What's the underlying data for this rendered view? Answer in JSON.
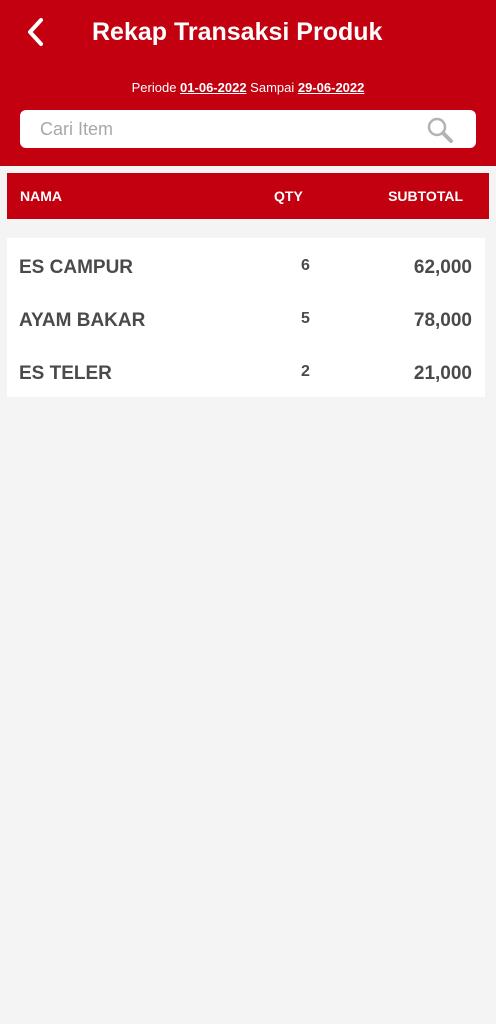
{
  "header": {
    "title": "Rekap Transaksi Produk",
    "period": {
      "prefix": "Periode",
      "start_date": "01-06-2022",
      "middle": "Sampai",
      "end_date": "29-06-2022"
    }
  },
  "search": {
    "placeholder": "Cari Item",
    "value": ""
  },
  "table": {
    "columns": {
      "name": "NAMA",
      "qty": "QTY",
      "subtotal": "SUBTOTAL"
    },
    "rows": [
      {
        "name": "ES CAMPUR",
        "qty": "6",
        "subtotal": "62,000"
      },
      {
        "name": "AYAM BAKAR",
        "qty": "5",
        "subtotal": "78,000"
      },
      {
        "name": "ES TELER",
        "qty": "2",
        "subtotal": "21,000"
      }
    ]
  },
  "colors": {
    "primary": "#c2000f",
    "background": "#f4f4f4",
    "text": "#4a4a4a"
  },
  "icons": {
    "back": "chevron-left-icon",
    "search": "search-icon"
  }
}
